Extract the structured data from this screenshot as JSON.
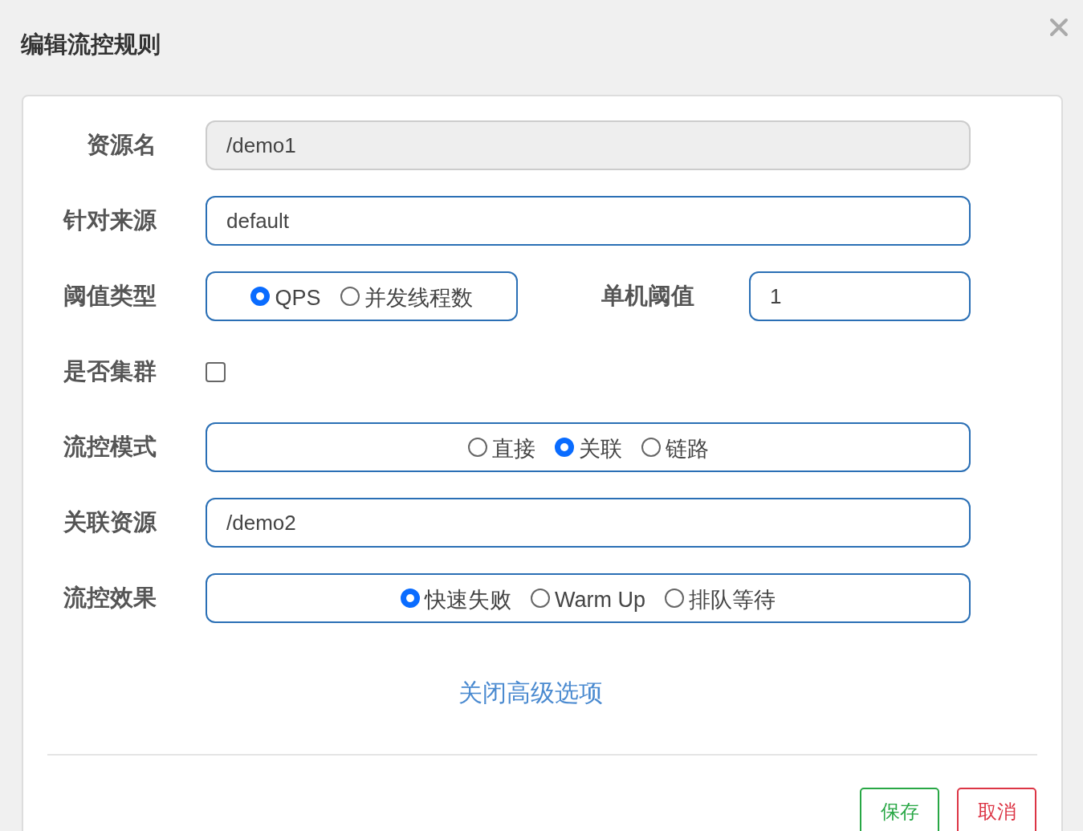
{
  "dialog": {
    "title": "编辑流控规则"
  },
  "rows": [
    {
      "kind": "input",
      "label": "资源名",
      "value": "/demo1",
      "disabled": true
    },
    {
      "kind": "input",
      "label": "针对来源",
      "value": "default",
      "disabled": false
    },
    {
      "kind": "radio_input",
      "label": "阈值类型",
      "options": [
        {
          "label": "QPS",
          "selected": true
        },
        {
          "label": "并发线程数",
          "selected": false
        }
      ],
      "input_label": "单机阈值",
      "input_value": "1"
    },
    {
      "kind": "checkbox",
      "label": "是否集群",
      "checked": false
    },
    {
      "kind": "radio",
      "label": "流控模式",
      "options": [
        {
          "label": "直接",
          "selected": false
        },
        {
          "label": "关联",
          "selected": true
        },
        {
          "label": "链路",
          "selected": false
        }
      ]
    },
    {
      "kind": "input",
      "label": "关联资源",
      "value": "/demo2",
      "disabled": false
    },
    {
      "kind": "radio",
      "label": "流控效果",
      "options": [
        {
          "label": "快速失败",
          "selected": true
        },
        {
          "label": "Warm Up",
          "selected": false
        },
        {
          "label": "排队等待",
          "selected": false
        }
      ]
    }
  ],
  "link": "关闭高级选项",
  "buttons": [
    {
      "kind": "save",
      "label": "保存"
    },
    {
      "kind": "cancel",
      "label": "取消"
    }
  ]
}
